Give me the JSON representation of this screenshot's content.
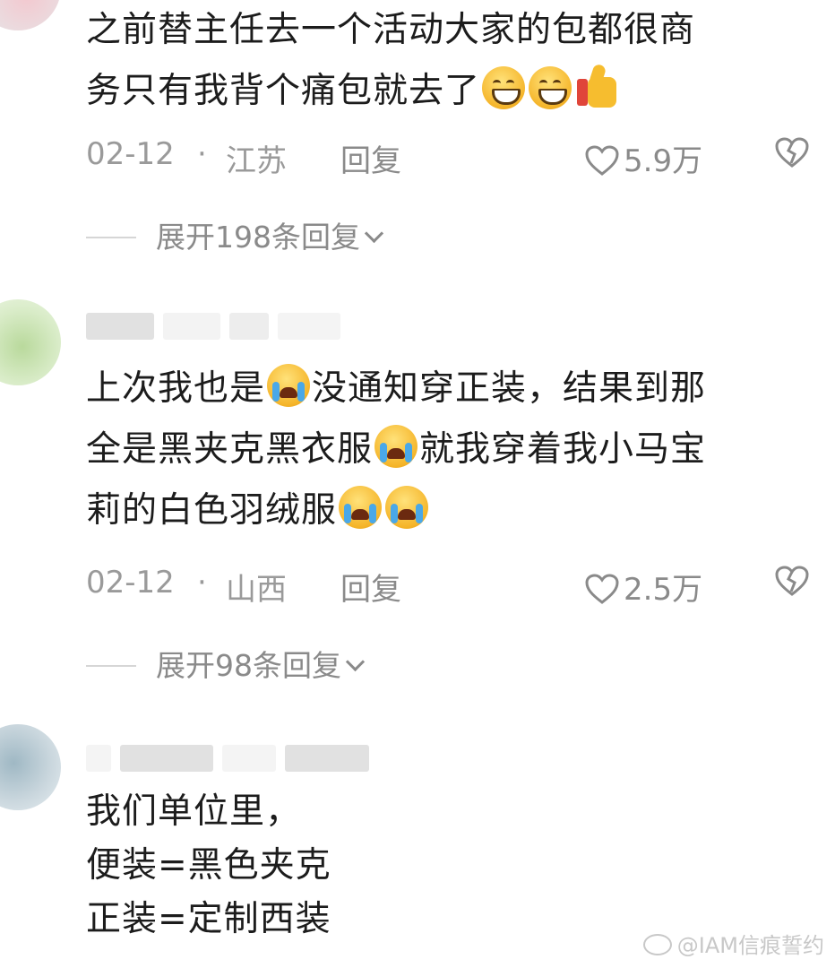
{
  "comments": [
    {
      "lines": [
        "之前替主任去一个活动大家的包都很商",
        "务只有我背个痛包就去了"
      ],
      "date": "02-12",
      "dot": "·",
      "location": "江苏",
      "reply_label": "回复",
      "likes": "5.9万",
      "expand_label": "展开198条回复"
    },
    {
      "lines": [
        "上次我也是",
        "没通知穿正装，结果到那",
        "全是黑夹克黑衣服",
        "就我穿着我小马宝",
        "莉的白色羽绒服"
      ],
      "date": "02-12",
      "dot": "·",
      "location": "山西",
      "reply_label": "回复",
      "likes": "2.5万",
      "expand_label": "展开98条回复"
    },
    {
      "lines": [
        "我们单位里，",
        "便装=黑色夹克",
        "正装=定制西装"
      ]
    }
  ],
  "watermark": "@IAM信痕誓约",
  "icons": {
    "like": "heart-outline-icon",
    "dislike": "broken-heart-icon",
    "expand": "chevron-down-icon",
    "emoji_grin": "grinning-face-emoji",
    "emoji_thumb": "thumbs-up-emoji",
    "emoji_cry": "loudly-crying-face-emoji"
  }
}
